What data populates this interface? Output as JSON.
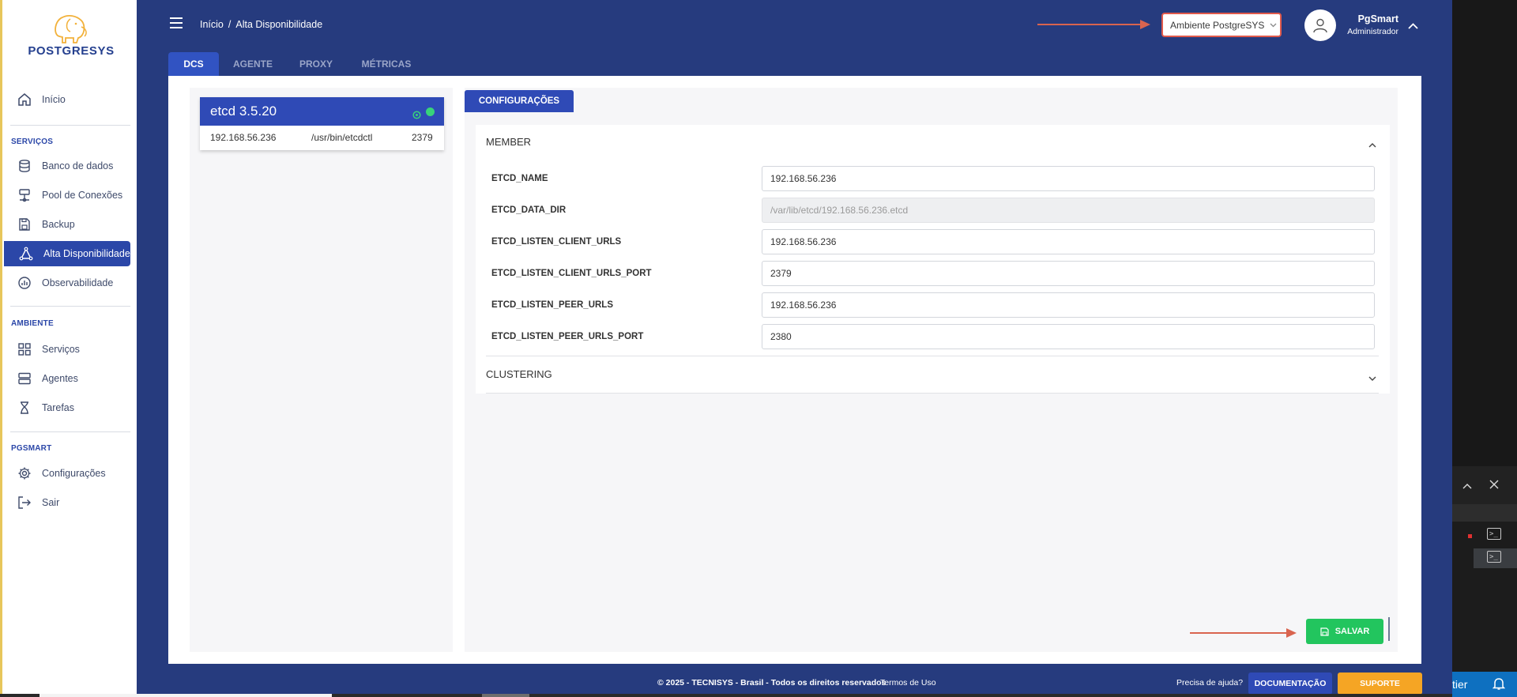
{
  "brand": {
    "logo_text": "POSTGRESYS",
    "primary": "#263b7e",
    "accent": "#2f4ab6"
  },
  "sidebar": {
    "top": [
      {
        "label": "Início",
        "icon": "home-icon"
      }
    ],
    "sections": [
      {
        "title": "SERVIÇOS",
        "items": [
          {
            "label": "Banco de dados",
            "icon": "database-icon"
          },
          {
            "label": "Pool de Conexões",
            "icon": "network-icon"
          },
          {
            "label": "Backup",
            "icon": "save-icon"
          },
          {
            "label": "Alta Disponibilidade",
            "icon": "triangle-nodes-icon",
            "active": true
          },
          {
            "label": "Observabilidade",
            "icon": "chart-pie-icon"
          }
        ]
      },
      {
        "title": "AMBIENTE",
        "items": [
          {
            "label": "Serviços",
            "icon": "grid-icon"
          },
          {
            "label": "Agentes",
            "icon": "server-icon"
          },
          {
            "label": "Tarefas",
            "icon": "hourglass-icon"
          }
        ]
      },
      {
        "title": "PGSMART",
        "items": [
          {
            "label": "Configurações",
            "icon": "gear-icon"
          },
          {
            "label": "Sair",
            "icon": "logout-icon"
          }
        ]
      }
    ]
  },
  "header": {
    "breadcrumb": [
      "Início",
      "/",
      "Alta Disponibilidade"
    ],
    "environment_select": "Ambiente PostgreSYS",
    "user_name": "PgSmart",
    "user_role": "Administrador"
  },
  "tabs": [
    {
      "label": "DCS",
      "active": true
    },
    {
      "label": "AGENTE"
    },
    {
      "label": "PROXY"
    },
    {
      "label": "MÉTRICAS"
    }
  ],
  "etcd_card": {
    "title": "etcd 3.5.20",
    "ip": "192.168.56.236",
    "binary": "/usr/bin/etcdctl",
    "port": "2379"
  },
  "config": {
    "tab_label": "CONFIGURAÇÕES",
    "member_title": "MEMBER",
    "fields": [
      {
        "label": "ETCD_NAME",
        "value": "192.168.56.236",
        "disabled": false
      },
      {
        "label": "ETCD_DATA_DIR",
        "value": "/var/lib/etcd/192.168.56.236.etcd",
        "disabled": true
      },
      {
        "label": "ETCD_LISTEN_CLIENT_URLS",
        "value": "192.168.56.236",
        "disabled": false
      },
      {
        "label": "ETCD_LISTEN_CLIENT_URLS_PORT",
        "value": "2379",
        "disabled": false
      },
      {
        "label": "ETCD_LISTEN_PEER_URLS",
        "value": "192.168.56.236",
        "disabled": false
      },
      {
        "label": "ETCD_LISTEN_PEER_URLS_PORT",
        "value": "2380",
        "disabled": false
      }
    ],
    "clustering_title": "CLUSTERING",
    "save_label": "SALVAR"
  },
  "footer": {
    "copyright": "© 2025 - TECNISYS - Brasil - Todos os direitos reservados",
    "terms": "Termos de Uso",
    "help": "Precisa de ajuda?",
    "docs_button": "DOCUMENTAÇÃO",
    "support_button": "SUPORTE"
  },
  "side_window": {
    "status_text": "tier"
  }
}
